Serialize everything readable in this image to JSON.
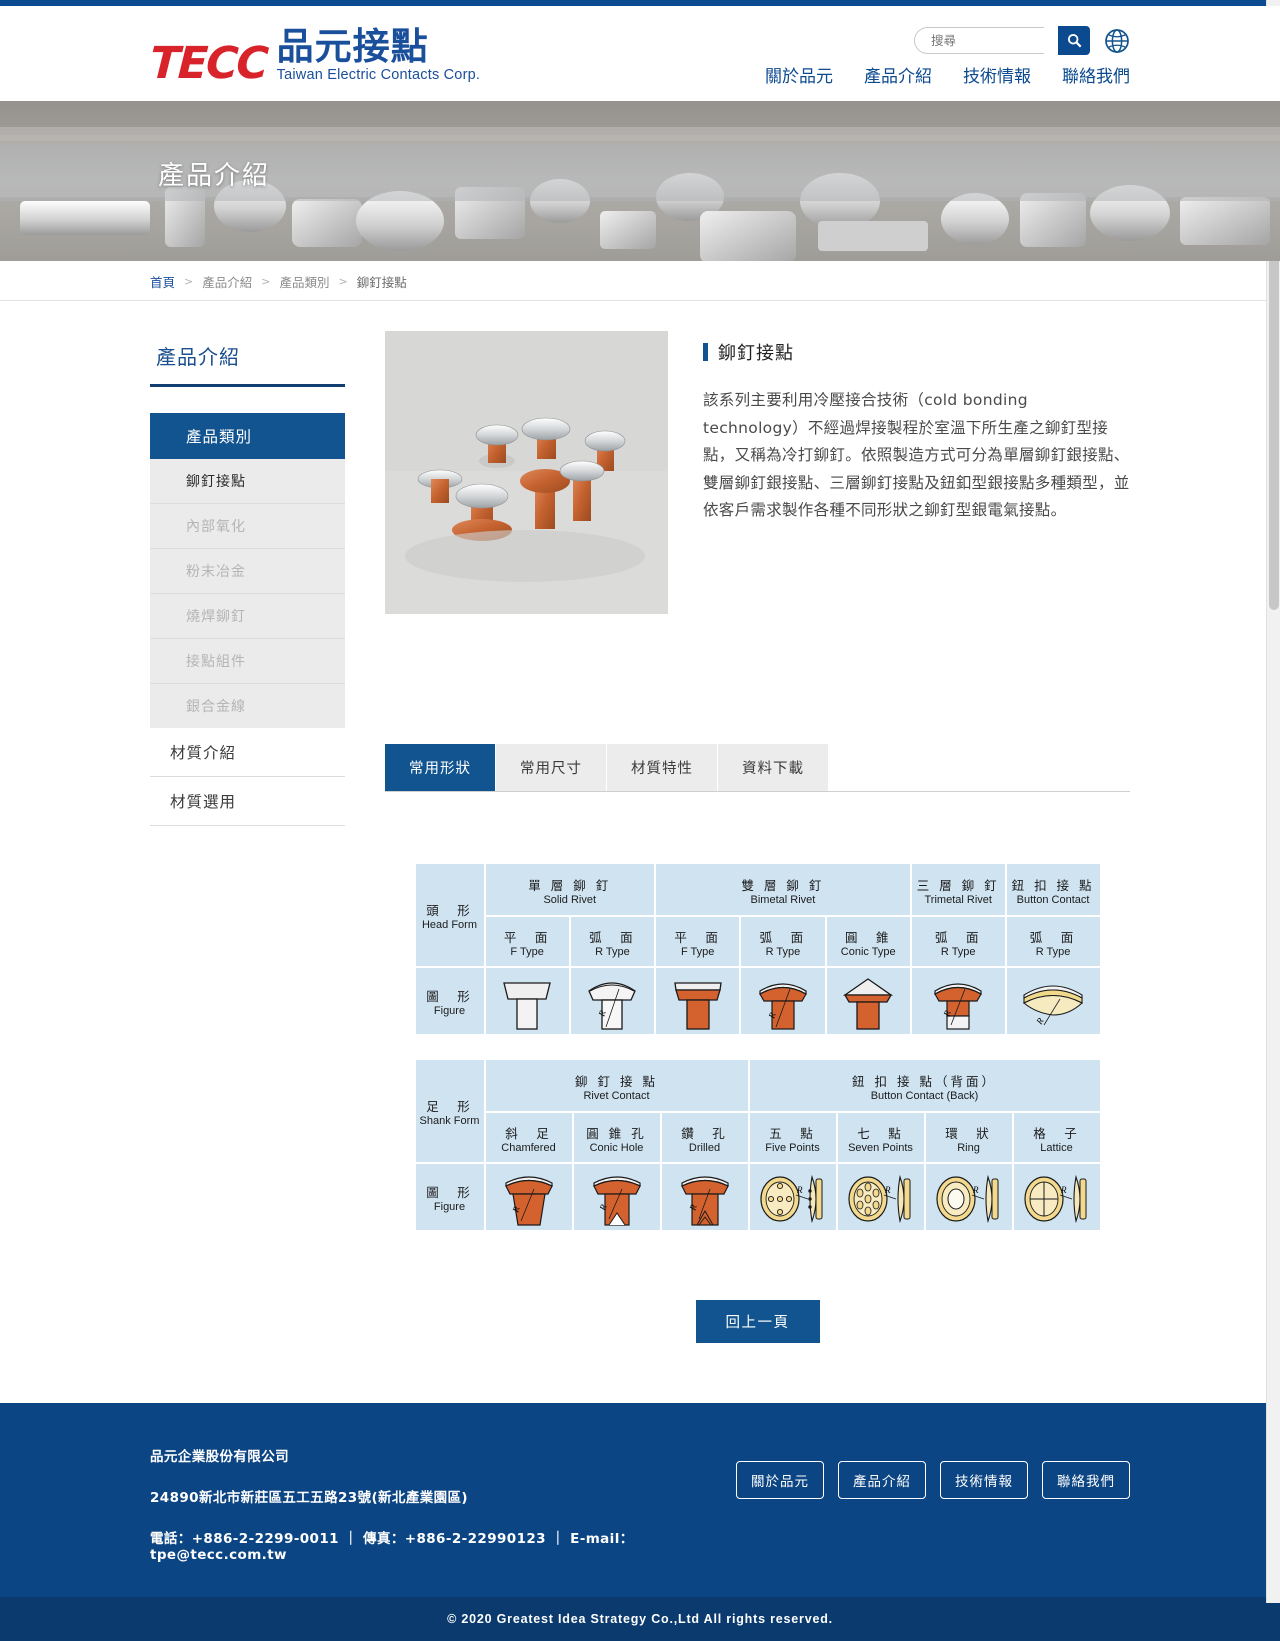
{
  "brand": {
    "logo_mark": "TECC",
    "logo_cn": "品元接點",
    "logo_en": "Taiwan Electric Contacts Corp.",
    "red": "#d8232a",
    "blue": "#1a4f9c"
  },
  "search": {
    "placeholder": "搜尋",
    "value": "",
    "icon": "search-icon",
    "lang_icon": "globe-icon"
  },
  "nav": [
    {
      "label": "關於品元"
    },
    {
      "label": "產品介紹"
    },
    {
      "label": "技術情報"
    },
    {
      "label": "聯絡我們"
    }
  ],
  "hero": {
    "title": "產品介紹"
  },
  "breadcrumb": [
    {
      "label": "首頁",
      "type": "link"
    },
    {
      "label": "產品介紹",
      "type": "item"
    },
    {
      "label": "產品類別",
      "type": "item"
    },
    {
      "label": "鉚釘接點",
      "type": "current"
    }
  ],
  "breadcrumb_separator": ">",
  "sidebar": {
    "title": "產品介紹",
    "group_header": "產品類別",
    "items": [
      {
        "label": "鉚釘接點",
        "active": true
      },
      {
        "label": "內部氧化",
        "active": false
      },
      {
        "label": "粉末冶金",
        "active": false
      },
      {
        "label": "燒焊鉚釘",
        "active": false
      },
      {
        "label": "接點組件",
        "active": false
      },
      {
        "label": "銀合金線",
        "active": false
      }
    ],
    "links": [
      {
        "label": "材質介紹"
      },
      {
        "label": "材質選用"
      }
    ]
  },
  "product": {
    "title": "鉚釘接點",
    "description": "該系列主要利用冷壓接合技術（cold bonding technology）不經過焊接製程於室溫下所生產之鉚釘型接點，又稱為冷打鉚釘。依照製造方式可分為單層鉚釘銀接點、雙層鉚釘銀接點、三層鉚釘接點及鈕釦型銀接點多種類型，並依客戶需求製作各種不同形狀之鉚釘型銀電氣接點。",
    "photo_alt": "rivet-contacts-photo"
  },
  "tabs": [
    {
      "label": "常用形狀",
      "active": true
    },
    {
      "label": "常用尺寸",
      "active": false
    },
    {
      "label": "材質特性",
      "active": false
    },
    {
      "label": "資料下載",
      "active": false
    }
  ],
  "spec_tables": [
    {
      "row_label_cn": "頭　形",
      "row_label_en": "Head Form",
      "figure_label_cn": "圖　形",
      "figure_label_en": "Figure",
      "groups": [
        {
          "cn": "單 層 鉚 釘",
          "en": "Solid Rivet",
          "span": 2
        },
        {
          "cn": "雙 層 鉚 釘",
          "en": "Bimetal Rivet",
          "span": 3
        },
        {
          "cn": "三 層 鉚 釘",
          "en": "Trimetal Rivet",
          "span": 1
        },
        {
          "cn": "鈕 扣 接 點",
          "en": "Button Contact",
          "span": 1
        }
      ],
      "columns": [
        {
          "cn": "平　面",
          "en": "F Type",
          "figure": "solid-flat"
        },
        {
          "cn": "弧　面",
          "en": "R Type",
          "figure": "solid-round"
        },
        {
          "cn": "平　面",
          "en": "F Type",
          "figure": "bimetal-flat"
        },
        {
          "cn": "弧　面",
          "en": "R Type",
          "figure": "bimetal-round"
        },
        {
          "cn": "圓　錐",
          "en": "Conic Type",
          "figure": "bimetal-conic"
        },
        {
          "cn": "弧　面",
          "en": "R  Type",
          "figure": "trimetal-round"
        },
        {
          "cn": "弧　面",
          "en": "R Type",
          "figure": "button-round"
        }
      ]
    },
    {
      "row_label_cn": "足　形",
      "row_label_en": "Shank Form",
      "figure_label_cn": "圖　形",
      "figure_label_en": "Figure",
      "groups": [
        {
          "cn": "鉚 釘 接 點",
          "en": "Rivet Contact",
          "span": 3
        },
        {
          "cn": "鈕 扣 接 點（背面）",
          "en": "Button Contact (Back)",
          "span": 4
        }
      ],
      "columns": [
        {
          "cn": "斜　足",
          "en": "Chamfered",
          "figure": "shank-chamfered"
        },
        {
          "cn": "圓 錐 孔",
          "en": "Conic Hole",
          "figure": "shank-conic-hole"
        },
        {
          "cn": "鑽　孔",
          "en": "Drilled",
          "figure": "shank-drilled"
        },
        {
          "cn": "五　點",
          "en": "Five Points",
          "figure": "back-five-points"
        },
        {
          "cn": "七　點",
          "en": "Seven Points",
          "figure": "back-seven-points"
        },
        {
          "cn": "環　狀",
          "en": "Ring",
          "figure": "back-ring"
        },
        {
          "cn": "格　子",
          "en": "Lattice",
          "figure": "back-lattice"
        }
      ]
    }
  ],
  "back_button": {
    "label": "回上一頁"
  },
  "footer": {
    "company": "品元企業股份有限公司",
    "address": "24890新北市新莊區五工五路23號(新北產業園區)",
    "contact": "電話：+886-2-2299-0011  ｜  傳真：+886-2-22990123  ｜  E-mail：tpe@tecc.com.tw",
    "buttons": [
      {
        "label": "關於品元"
      },
      {
        "label": "產品介紹"
      },
      {
        "label": "技術情報"
      },
      {
        "label": "聯絡我們"
      }
    ],
    "copyright": "© 2020 Greatest Idea Strategy Co.,Ltd All rights reserved.",
    "bg": "#0c4583",
    "bar_bg": "#0a3a6e"
  }
}
